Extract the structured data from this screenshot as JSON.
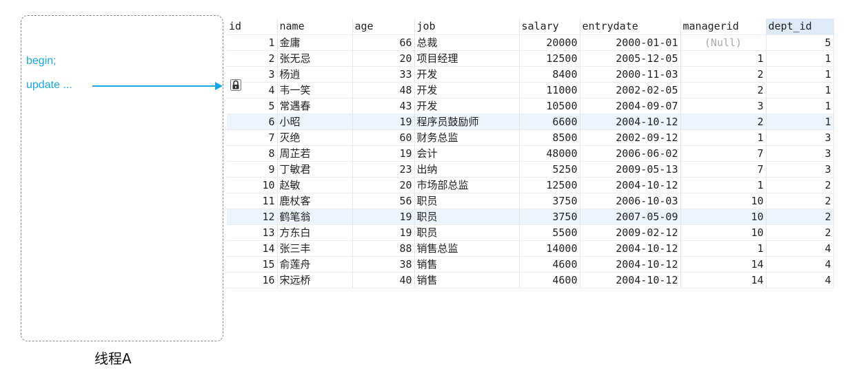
{
  "thread": {
    "label": "线程A",
    "sql_lines": [
      "begin;",
      "update ..."
    ]
  },
  "table": {
    "columns": [
      "id",
      "name",
      "age",
      "job",
      "salary",
      "entrydate",
      "managerid",
      "dept_id"
    ],
    "selected_column": "dept_id",
    "locked_row_id": 3,
    "rows": [
      {
        "id": "1",
        "name": "金庸",
        "age": "66",
        "job": "总裁",
        "salary": "20000",
        "entrydate": "2000-01-01",
        "managerid": "(Null)",
        "dept_id": "5"
      },
      {
        "id": "2",
        "name": "张无忌",
        "age": "20",
        "job": "项目经理",
        "salary": "12500",
        "entrydate": "2005-12-05",
        "managerid": "1",
        "dept_id": "1"
      },
      {
        "id": "3",
        "name": "杨逍",
        "age": "33",
        "job": "开发",
        "salary": "8400",
        "entrydate": "2000-11-03",
        "managerid": "2",
        "dept_id": "1"
      },
      {
        "id": "4",
        "name": "韦一笑",
        "age": "48",
        "job": "开发",
        "salary": "11000",
        "entrydate": "2002-02-05",
        "managerid": "2",
        "dept_id": "1"
      },
      {
        "id": "5",
        "name": "常遇春",
        "age": "43",
        "job": "开发",
        "salary": "10500",
        "entrydate": "2004-09-07",
        "managerid": "3",
        "dept_id": "1"
      },
      {
        "id": "6",
        "name": "小昭",
        "age": "19",
        "job": "程序员鼓励师",
        "salary": "6600",
        "entrydate": "2004-10-12",
        "managerid": "2",
        "dept_id": "1"
      },
      {
        "id": "7",
        "name": "灭绝",
        "age": "60",
        "job": "财务总监",
        "salary": "8500",
        "entrydate": "2002-09-12",
        "managerid": "1",
        "dept_id": "3"
      },
      {
        "id": "8",
        "name": "周芷若",
        "age": "19",
        "job": "会计",
        "salary": "48000",
        "entrydate": "2006-06-02",
        "managerid": "7",
        "dept_id": "3"
      },
      {
        "id": "9",
        "name": "丁敏君",
        "age": "23",
        "job": "出纳",
        "salary": "5250",
        "entrydate": "2009-05-13",
        "managerid": "7",
        "dept_id": "3"
      },
      {
        "id": "10",
        "name": "赵敏",
        "age": "20",
        "job": "市场部总监",
        "salary": "12500",
        "entrydate": "2004-10-12",
        "managerid": "1",
        "dept_id": "2"
      },
      {
        "id": "11",
        "name": "鹿杖客",
        "age": "56",
        "job": "职员",
        "salary": "3750",
        "entrydate": "2006-10-03",
        "managerid": "10",
        "dept_id": "2"
      },
      {
        "id": "12",
        "name": "鹤笔翁",
        "age": "19",
        "job": "职员",
        "salary": "3750",
        "entrydate": "2007-05-09",
        "managerid": "10",
        "dept_id": "2"
      },
      {
        "id": "13",
        "name": "方东白",
        "age": "19",
        "job": "职员",
        "salary": "5500",
        "entrydate": "2009-02-12",
        "managerid": "10",
        "dept_id": "2"
      },
      {
        "id": "14",
        "name": "张三丰",
        "age": "88",
        "job": "销售总监",
        "salary": "14000",
        "entrydate": "2004-10-12",
        "managerid": "1",
        "dept_id": "4"
      },
      {
        "id": "15",
        "name": "俞莲舟",
        "age": "38",
        "job": "销售",
        "salary": "4600",
        "entrydate": "2004-10-12",
        "managerid": "14",
        "dept_id": "4"
      },
      {
        "id": "16",
        "name": "宋远桥",
        "age": "40",
        "job": "销售",
        "salary": "4600",
        "entrydate": "2004-10-12",
        "managerid": "14",
        "dept_id": "4"
      }
    ]
  },
  "colors": {
    "sql_text": "#15a8e0",
    "arrow": "#15a8e0",
    "header_selected": "#dfeaf7",
    "row_highlight": "#eef4fb",
    "null_text": "#aaaaaa"
  },
  "icons": {
    "arrow": "arrow-right-icon",
    "lock": "lock-icon"
  }
}
